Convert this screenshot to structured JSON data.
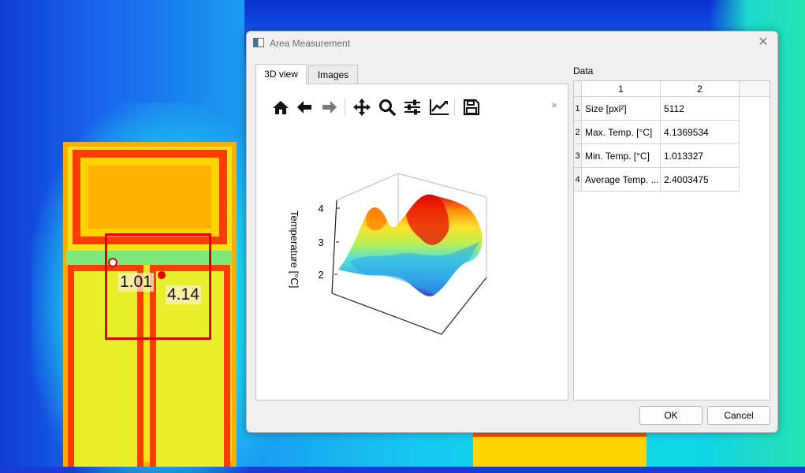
{
  "background": {
    "measurement": {
      "min_value": "1.01",
      "max_value": "4.14"
    },
    "colors": {
      "rect": "#e00000"
    }
  },
  "dialog": {
    "title": "Area Measurement",
    "close_glyph": "✕",
    "tabs": [
      {
        "label": "3D view",
        "active": true
      },
      {
        "label": "Images",
        "active": false
      }
    ],
    "toolbar": {
      "icons": [
        "home-icon",
        "back-arrow-icon",
        "forward-arrow-icon",
        "pan-icon",
        "zoom-icon",
        "configure-subplots-icon",
        "edit-axes-icon",
        "save-icon"
      ],
      "more": "»"
    },
    "plot": {
      "zlabel": "Temperature [°C]",
      "zticks": [
        "4",
        "3",
        "2"
      ]
    },
    "data_section": {
      "label": "Data",
      "columns": [
        "1",
        "2"
      ],
      "rows": [
        {
          "num": "1",
          "name": "Size [pxl²]",
          "value": "5112"
        },
        {
          "num": "2",
          "name": "Max. Temp. [°C]",
          "value": "4.1369534"
        },
        {
          "num": "3",
          "name": "Min. Temp. [°C]",
          "value": "1.013327"
        },
        {
          "num": "4",
          "name": "Average Temp. ...",
          "value": "2.4003475"
        }
      ]
    },
    "buttons": {
      "ok": "OK",
      "cancel": "Cancel"
    }
  }
}
